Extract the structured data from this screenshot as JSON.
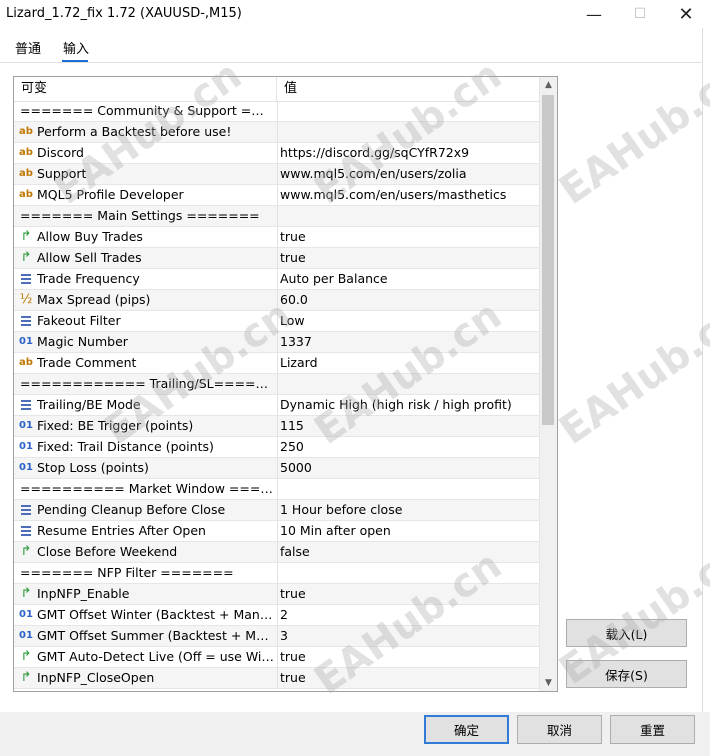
{
  "window": {
    "title": "Lizard_1.72_fix 1.72 (XAUUSD-,M15)",
    "minimize_icon": "minimize-icon",
    "maximize_icon": "maximize-icon",
    "close_icon": "close-icon"
  },
  "tabs": [
    {
      "label": "普通"
    },
    {
      "label": "输入"
    }
  ],
  "grid": {
    "columns": [
      "可变",
      "值"
    ],
    "rows": [
      {
        "name": "======= Community & Support ====...",
        "value": "",
        "icon": ""
      },
      {
        "name": "Perform a Backtest before use!",
        "value": "",
        "icon": "ab"
      },
      {
        "name": "Discord",
        "value": "https://discord.gg/sqCYfR72x9",
        "icon": "ab"
      },
      {
        "name": "Support",
        "value": "www.mql5.com/en/users/zolia",
        "icon": "ab"
      },
      {
        "name": "MQL5 Profile Developer",
        "value": "www.mql5.com/en/users/masthetics",
        "icon": "ab"
      },
      {
        "name": "======= Main Settings =======",
        "value": "",
        "icon": ""
      },
      {
        "name": "Allow Buy Trades",
        "value": "true",
        "icon": "bool"
      },
      {
        "name": "Allow Sell Trades",
        "value": "true",
        "icon": "bool"
      },
      {
        "name": "Trade Frequency",
        "value": "Auto per Balance",
        "icon": "enum"
      },
      {
        "name": "Max Spread (pips)",
        "value": "60.0",
        "icon": "frac"
      },
      {
        "name": "Fakeout Filter",
        "value": "Low",
        "icon": "enum"
      },
      {
        "name": "Magic Number",
        "value": "1337",
        "icon": "num"
      },
      {
        "name": "Trade Comment",
        "value": "Lizard",
        "icon": "ab"
      },
      {
        "name": "============ Trailing/SL=======...",
        "value": "",
        "icon": ""
      },
      {
        "name": "Trailing/BE Mode",
        "value": "Dynamic High (high risk / high profit)",
        "icon": "enum"
      },
      {
        "name": "Fixed: BE Trigger (points)",
        "value": "115",
        "icon": "num"
      },
      {
        "name": "Fixed: Trail Distance (points)",
        "value": "250",
        "icon": "num"
      },
      {
        "name": "Stop Loss (points)",
        "value": "5000",
        "icon": "num"
      },
      {
        "name": "========== Market Window ======...",
        "value": "",
        "icon": ""
      },
      {
        "name": "Pending Cleanup Before Close",
        "value": "1 Hour before close",
        "icon": "enum"
      },
      {
        "name": "Resume Entries After Open",
        "value": "10 Min after open",
        "icon": "enum"
      },
      {
        "name": "Close Before Weekend",
        "value": "false",
        "icon": "bool"
      },
      {
        "name": "======= NFP Filter =======",
        "value": "",
        "icon": ""
      },
      {
        "name": "InpNFP_Enable",
        "value": "true",
        "icon": "bool"
      },
      {
        "name": "GMT Offset Winter (Backtest + Manual...",
        "value": "2",
        "icon": "num"
      },
      {
        "name": "GMT Offset Summer (Backtest + Manu...",
        "value": "3",
        "icon": "num"
      },
      {
        "name": "GMT Auto-Detect Live (Off = use Winte...",
        "value": "true",
        "icon": "bool"
      },
      {
        "name": "InpNFP_CloseOpen",
        "value": "true",
        "icon": "bool"
      }
    ]
  },
  "buttons": {
    "load": "载入(L)",
    "save": "保存(S)",
    "ok": "确定",
    "cancel": "取消",
    "reset": "重置"
  },
  "watermark": "EAHub.cn",
  "colors": {
    "accent": "#2f7bd6",
    "bool_icon": "#2a9a3a",
    "string_icon": "#c07800",
    "number_icon": "#2b63c9"
  }
}
